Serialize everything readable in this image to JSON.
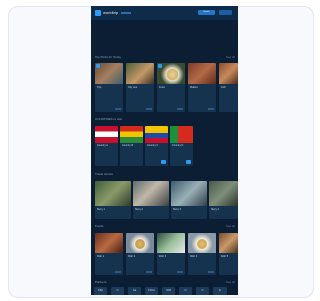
{
  "header": {
    "brand": "worldtrip",
    "btn_primary": "Search",
    "btn_secondary": "Menu"
  },
  "colors": {
    "bg": "#0b1e33",
    "accent": "#2d9cf0",
    "card": "#15324f"
  },
  "sections": {
    "s1": {
      "title": "Top Picks for Today",
      "link": "See all",
      "cards": [
        {
          "caption": "Trip"
        },
        {
          "caption": "City tour"
        },
        {
          "caption": "Food"
        },
        {
          "caption": "Market"
        },
        {
          "caption": "Grill"
        }
      ]
    },
    "s2": {
      "title": "COUNTRIES to visit",
      "link": "",
      "cards": [
        {
          "caption": "Country A"
        },
        {
          "caption": "Country B"
        },
        {
          "caption": "Country C"
        },
        {
          "caption": "Country D"
        }
      ]
    },
    "s3": {
      "title": "Travel stories",
      "link": "",
      "cards": [
        {
          "caption": "Story 1"
        },
        {
          "caption": "Story 2"
        },
        {
          "caption": "Story 3"
        },
        {
          "caption": "Story 4"
        }
      ]
    },
    "s4": {
      "title": "Foods",
      "link": "See all",
      "cards": [
        {
          "caption": "Dish 1"
        },
        {
          "caption": "Dish 2"
        },
        {
          "caption": "Dish 3"
        },
        {
          "caption": "Dish 4"
        },
        {
          "caption": "Dish 5"
        }
      ]
    },
    "s5": {
      "title": "Partners",
      "link": "See all",
      "logos": [
        "DIGI",
        "O",
        "Ga",
        "KOLA",
        "NIM",
        "O",
        "D",
        "E"
      ]
    }
  }
}
